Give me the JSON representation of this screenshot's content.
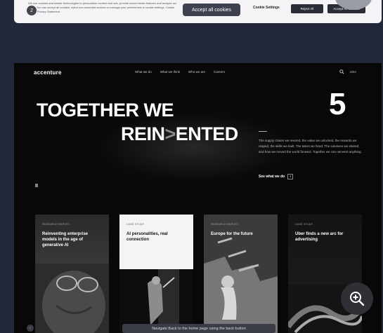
{
  "cookie": {
    "step_number": "2",
    "text": "We use cookies and similar technologies to personalize content and ads, provide social media features and analyze our traffic. You can accept all cookies, reject non-essential cookies or manage your preferences in cookie settings. Cookie Policy. Privacy Statement.",
    "accept_label": "Accept all cookies",
    "settings_label": "Cookie Settings",
    "reject_label": "Reject All",
    "accept_all_label": "Accept All Cookies"
  },
  "nav": {
    "logo": "accenture",
    "items": [
      "What we do",
      "What we think",
      "Who we are",
      "Careers"
    ],
    "lang": "USA"
  },
  "hero": {
    "line1": "TOGETHER WE",
    "line2_a": "REIN",
    "line2_chev": ">",
    "line2_b": "ENTED",
    "number": "5",
    "description": "The supply chains we rewired, the value we unlocked, the rewards we reaped, the skills we built. The talent we hired. The solutions we shared, and how we moved the world forward. Together we can reinvent anything.",
    "cta": "See what we do",
    "cta_arrow": "›",
    "pause": "II"
  },
  "cards": [
    {
      "label": "RESEARCH REPORT",
      "title": "Reinventing enterprise models in the age of generative AI"
    },
    {
      "label": "CASE STUDY",
      "title": "AI personalities, real connection"
    },
    {
      "label": "RESEARCH REPORT",
      "title": "Europe for the future"
    },
    {
      "label": "CASE STUDY",
      "title": "Uber finds a new arc for advertising"
    }
  ],
  "zoom_icon": "zoom-in-icon",
  "tooltip": "Navigate Back to the home page using the back button",
  "bottom_dot": "‹"
}
